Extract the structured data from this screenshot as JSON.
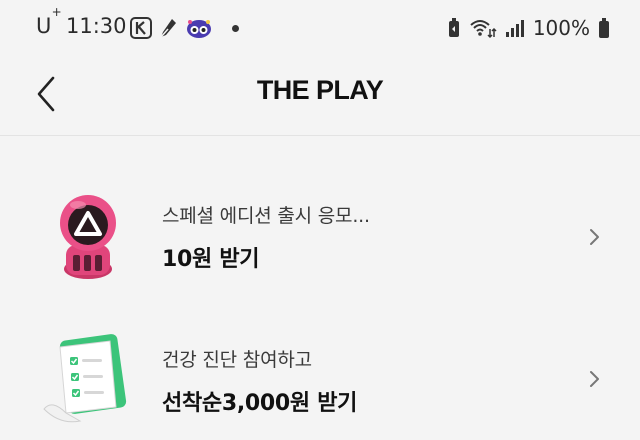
{
  "status_bar": {
    "carrier": "U",
    "carrier_sup": "+",
    "time": "11:30",
    "battery_percent": "100%",
    "icons": [
      "kakaopay-icon",
      "app-icon",
      "mascot-icon",
      "notification-dot",
      "battery-saver-icon",
      "wifi-icon",
      "signal-icon",
      "battery-icon"
    ]
  },
  "header": {
    "title": "THE PLAY",
    "back_icon": "chevron-left-icon"
  },
  "offers": [
    {
      "subtitle": "스페셜 에디션 출시 응모...",
      "reward": "10원 받기",
      "icon": "squid-game-guard-icon"
    },
    {
      "subtitle": "건강 진단 참여하고",
      "reward": "선착순3,000원 받기",
      "icon": "checklist-icon"
    }
  ],
  "colors": {
    "background": "#f4f4f4",
    "guard_pink": "#e0457b",
    "checklist_green": "#3cc47a"
  }
}
